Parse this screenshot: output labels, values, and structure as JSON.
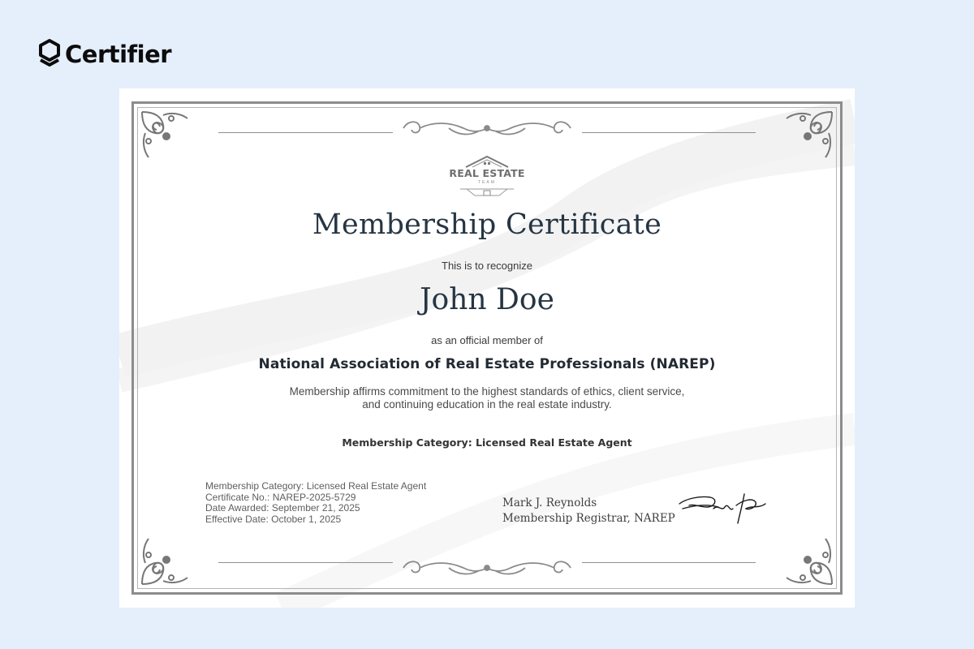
{
  "brand": {
    "name": "Certifier",
    "logo_icon": "certifier-shield-icon"
  },
  "certificate": {
    "logo": {
      "title": "REAL ESTATE",
      "subtitle": "TEAM",
      "icon": "house-roof-icon"
    },
    "title": "Membership Certificate",
    "intro": "This is to recognize",
    "recipient_name": "John Doe",
    "member_of_text": "as an official member of",
    "organization": "National Association of Real Estate Professionals (NAREP)",
    "description": "Membership affirms commitment to the highest standards of ethics, client service, and continuing education in the real estate industry.",
    "category_heading": "Membership Category: Licensed Real Estate Agent",
    "details": [
      "Membership Category: Licensed Real Estate Agent",
      "Certificate No.: NAREP-2025-5729",
      "Date Awarded: September 21, 2025",
      "Effective Date: October 1, 2025"
    ],
    "signer_name": "Mark J. Reynolds",
    "signer_title": "Membership Registrar, NAREP",
    "signature_icon": "handwritten-signature"
  },
  "colors": {
    "page_background": "#e5effc",
    "certificate_background": "#ffffff",
    "frame": "#8c8c8c",
    "heading": "#263543"
  }
}
